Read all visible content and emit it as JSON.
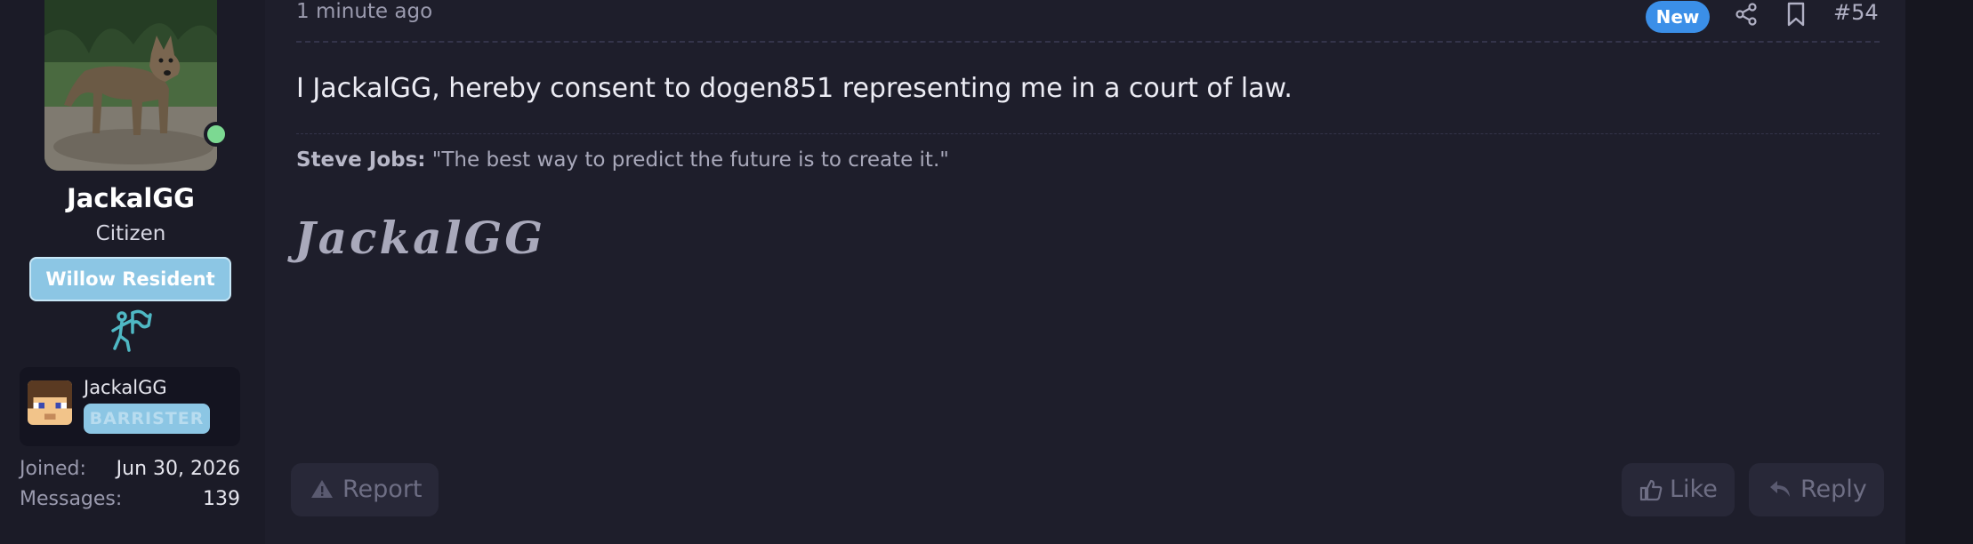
{
  "user": {
    "name": "JackalGG",
    "title": "Citizen",
    "banner": "Willow Resident",
    "minecraft": {
      "name": "JackalGG",
      "badge": "BARRISTER"
    },
    "joined_label": "Joined:",
    "joined_value": "Jun 30, 2026",
    "messages_label": "Messages:",
    "messages_value": "139"
  },
  "post": {
    "time": "1 minute ago",
    "new_badge": "New",
    "number": "#54",
    "message": "I JackalGG, hereby consent to dogen851 representing me in a court of law.",
    "signature": {
      "quote_author": "Steve Jobs:",
      "quote_text": " \"The best way to predict the future is to create it.\"",
      "name_script": "JackalGG"
    }
  },
  "actions": {
    "report": "Report",
    "like": "Like",
    "reply": "Reply"
  },
  "icons": [
    "share-icon",
    "bookmark-icon",
    "warning-icon",
    "thumbs-up-icon",
    "reply-icon",
    "award-icon"
  ],
  "colors": {
    "accent": "#3b8fe8",
    "banner": "#8cc6e4",
    "online": "#7cd992",
    "award": "#4fb8c4"
  }
}
